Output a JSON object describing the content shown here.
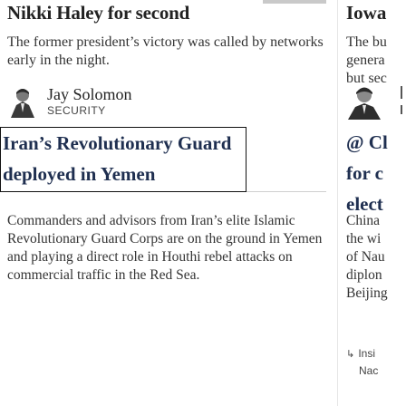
{
  "left": {
    "article_a": {
      "title": "Nikki Haley for second",
      "description": "The former president’s victory was called by networks early in the night."
    },
    "author": {
      "name": "Jay Solomon",
      "section": "SECURITY"
    },
    "article_b": {
      "title_lines": [
        "Iran’s Revolutionary Guard",
        "deployed in Yemen"
      ],
      "description": "Commanders and advisors from Iran’s elite Islamic Revolutionary Guard Corps are on the ground in Yemen and playing a direct role in Houthi rebel attacks on commercial traffic in the Red Sea."
    }
  },
  "right": {
    "article_c": {
      "title": "Iowa",
      "description_lines": [
        "The bu",
        "genera",
        "but sec"
      ]
    },
    "article_d": {
      "title_lines": [
        "@ Cl",
        "for c",
        "elect"
      ],
      "description_lines": [
        "China",
        "the wi",
        "of Nau",
        "diplon",
        "Beijing"
      ]
    },
    "insight": {
      "icon": "insight-arrow-icon",
      "line1": "Insi",
      "line2": "Nac"
    }
  },
  "colors": {
    "headline_blue": "#1f2f50",
    "text": "#333333",
    "border": "#111111"
  }
}
